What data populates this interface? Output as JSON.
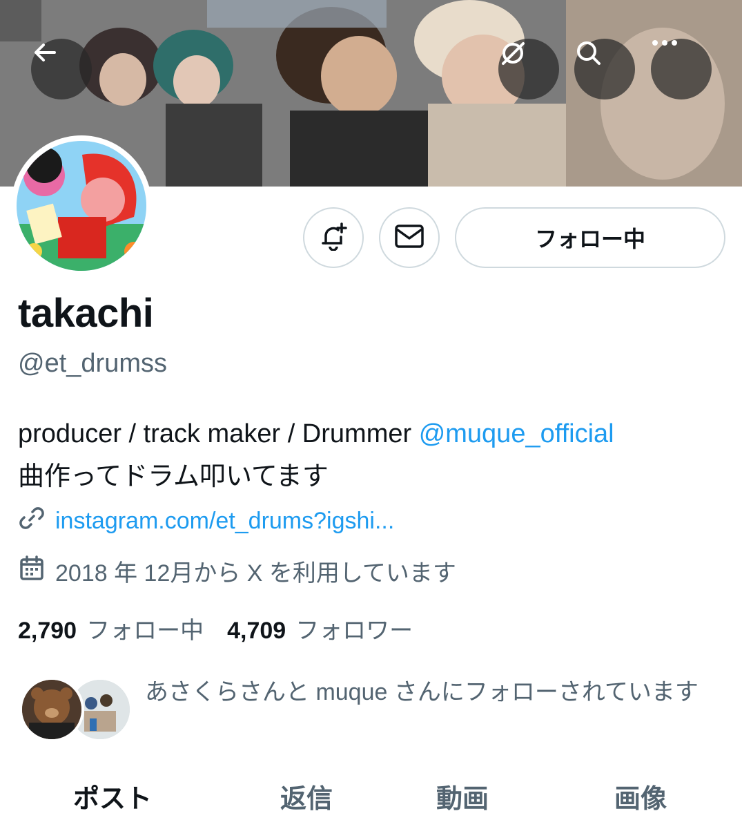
{
  "header": {
    "back_icon": "arrow-left-icon",
    "grok_icon": "grok-icon",
    "search_icon": "search-icon",
    "more_icon": "more-horizontal-icon"
  },
  "profile": {
    "display_name": "takachi",
    "handle": "@et_drumss",
    "bio_line1_prefix": "producer / track maker / Drummer ",
    "bio_mention": "@muque_official",
    "bio_line2": "曲作ってドラム叩いてます",
    "link": "instagram.com/et_drums?igshi...",
    "joined": "2018 年 12月から X を利用しています"
  },
  "actions": {
    "notify_icon": "bell-plus-icon",
    "dm_icon": "mail-icon",
    "follow_label": "フォロー中"
  },
  "stats": {
    "following_count": "2,790",
    "following_label": "フォロー中",
    "followers_count": "4,709",
    "followers_label": "フォロワー"
  },
  "followed_by": {
    "text": "あさくらさんと muque さんにフォローされています"
  },
  "tabs": [
    {
      "label": "ポスト",
      "active": true
    },
    {
      "label": "返信",
      "active": false
    },
    {
      "label": "動画",
      "active": false
    },
    {
      "label": "画像",
      "active": false
    }
  ],
  "colors": {
    "accent": "#1d9bf0",
    "text_primary": "#0f1419",
    "text_secondary": "#536471",
    "border": "#cfd9de"
  }
}
